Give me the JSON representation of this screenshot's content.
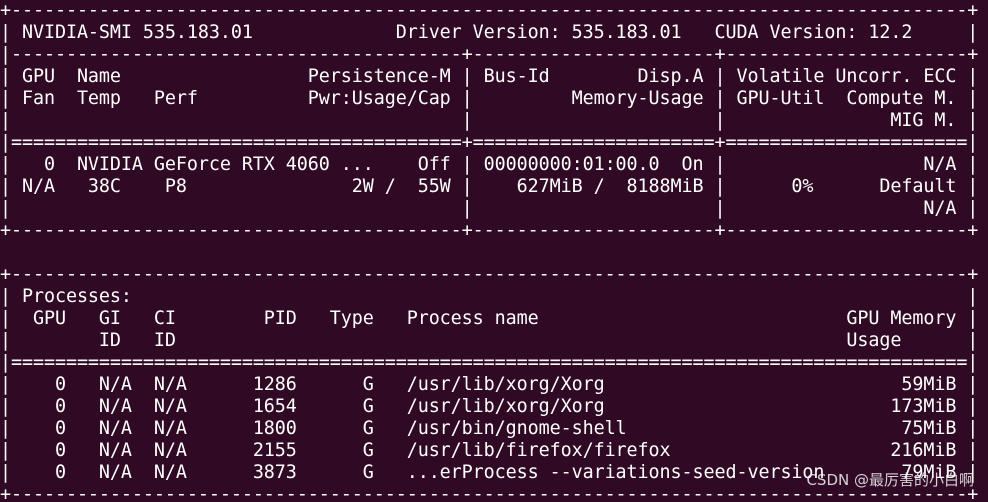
{
  "terminal": {
    "background": "#300a24",
    "foreground": "#ffffff",
    "lines": [
      "+---------------------------------------------------------------------------------------+",
      "| NVIDIA-SMI 535.183.01             Driver Version: 535.183.01   CUDA Version: 12.2     |",
      "|-----------------------------------------+----------------------+----------------------+",
      "| GPU  Name                 Persistence-M | Bus-Id        Disp.A | Volatile Uncorr. ECC |",
      "| Fan  Temp   Perf          Pwr:Usage/Cap |         Memory-Usage | GPU-Util  Compute M. |",
      "|                                         |                      |               MIG M. |",
      "|=========================================+======================+======================|",
      "|   0  NVIDIA GeForce RTX 4060 ...    Off | 00000000:01:00.0  On |                  N/A |",
      "| N/A   38C    P8               2W /  55W |    627MiB /  8188MiB |      0%      Default |",
      "|                                         |                      |                  N/A |",
      "+-----------------------------------------+----------------------+----------------------+",
      "",
      "+---------------------------------------------------------------------------------------+",
      "| Processes:                                                                            |",
      "|  GPU   GI   CI        PID   Type   Process name                            GPU Memory |",
      "|        ID   ID                                                             Usage      |",
      "|=======================================================================================|",
      "|    0   N/A  N/A      1286      G   /usr/lib/xorg/Xorg                           59MiB |",
      "|    0   N/A  N/A      1654      G   /usr/lib/xorg/Xorg                          173MiB |",
      "|    0   N/A  N/A      1800      G   /usr/bin/gnome-shell                         75MiB |",
      "|    0   N/A  N/A      2155      G   /usr/lib/firefox/firefox                    216MiB |",
      "|    0   N/A  N/A      3873      G   ...erProcess --variations-seed-version       79MiB |",
      "+---------------------------------------------------------------------------------------+"
    ]
  },
  "watermark": "CSDN @最厉害的小白啊"
}
